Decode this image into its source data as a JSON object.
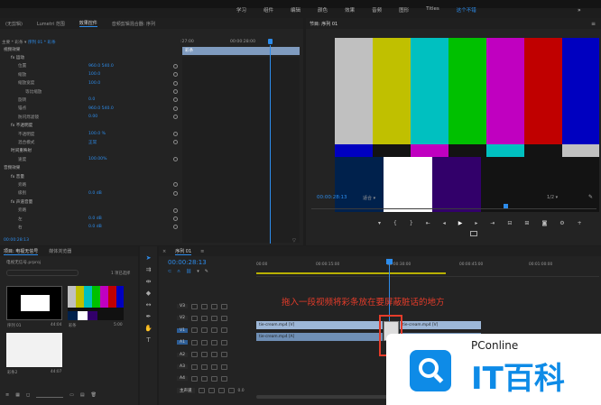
{
  "menubar": {
    "left_items": [
      "编辑",
      "标记",
      "图形",
      "视图",
      "窗口",
      "帮助"
    ],
    "top_tabs": [
      "学习",
      "组件",
      "编辑",
      "颜色",
      "效果",
      "音频",
      "图形",
      "Titles",
      "这个不错"
    ],
    "active_tab": "这个不错"
  },
  "effect_panel": {
    "tabs": [
      "(无剪辑)",
      "Lumetri 范围",
      "效果控件",
      "音频剪辑混合器: 序列"
    ],
    "active": "效果控件",
    "source": "主要 * 彩条",
    "seq": "序列 01 * 彩条",
    "time": ":27:00",
    "time2": "00:00:28:00",
    "clip_name": "彩条",
    "rows": [
      {
        "label": "视频效果",
        "indent": 0
      },
      {
        "label": "fx 运动",
        "indent": 1
      },
      {
        "label": "位置",
        "value": "960.0   540.0",
        "indent": 2
      },
      {
        "label": "缩放",
        "value": "100.0",
        "indent": 2
      },
      {
        "label": "缩放宽度",
        "value": "100.0",
        "indent": 2
      },
      {
        "label": "等比缩放",
        "indent": 3,
        "check": true
      },
      {
        "label": "旋转",
        "value": "0.0",
        "indent": 2
      },
      {
        "label": "锚点",
        "value": "960.0   540.0",
        "indent": 2
      },
      {
        "label": "防闪烁滤镜",
        "value": "0.00",
        "indent": 2
      },
      {
        "label": "fx 不透明度",
        "indent": 1
      },
      {
        "label": "不透明度",
        "value": "100.0 %",
        "indent": 2
      },
      {
        "label": "混合模式",
        "value": "正常",
        "indent": 2
      },
      {
        "label": "时间重映射",
        "indent": 1
      },
      {
        "label": "速度",
        "value": "100.00%",
        "indent": 2
      },
      {
        "label": "音频效果",
        "indent": 0
      },
      {
        "label": "fx 音量",
        "indent": 1
      },
      {
        "label": "旁路",
        "indent": 2
      },
      {
        "label": "级别",
        "value": "0.0 dB",
        "indent": 2
      },
      {
        "label": "fx 声道音量",
        "indent": 1
      },
      {
        "label": "旁路",
        "indent": 2
      },
      {
        "label": "左",
        "value": "0.0 dB",
        "indent": 2
      },
      {
        "label": "右",
        "value": "0.0 dB",
        "indent": 2
      }
    ],
    "bottom_time": "00:00:28:13"
  },
  "program": {
    "title": "节目: 序列 01",
    "time": "00:00:28:13",
    "fit": "适合",
    "ratio": "1/2",
    "duration": "00:00:55:05"
  },
  "project": {
    "tabs": [
      "项目: 电视无信号",
      "媒体浏览器"
    ],
    "filename": "电视无信号.prproj",
    "count": "1 项已选择",
    "items": [
      {
        "name": "序列 01",
        "dur": "44:04"
      },
      {
        "name": "彩条",
        "dur": "5:00"
      },
      {
        "name": "彩条2",
        "dur": "44:07"
      }
    ]
  },
  "timeline": {
    "title": "序列 01",
    "time": "00:00:28:13",
    "ruler": [
      "00:00",
      "00:00:15:00",
      "00:00:30:00",
      "00:00:45:00",
      "00:01:00:00"
    ],
    "tracks": [
      "V3",
      "V2",
      "V1",
      "A1",
      "A2",
      "A3",
      "A4",
      "主声道"
    ],
    "master_value": "0.0",
    "clip_v1": "tie-cream.mp4 [V]",
    "clip_v1b": "tie-cream.mp4 [V]",
    "clip_a1": "tie-cream.mp4 [A]",
    "clip_a1b": "tie-cream.mp4 [A]",
    "annotation": "拖入一段视频将彩条放在要屏蔽脏话的地方"
  },
  "watermark": {
    "site": "PConline",
    "brand": "IT百科"
  },
  "colors": {
    "accent": "#2d8ceb",
    "clip_video": "#9db7d7",
    "annotation": "#e53c2a",
    "playhead": "#2d8ceb"
  }
}
